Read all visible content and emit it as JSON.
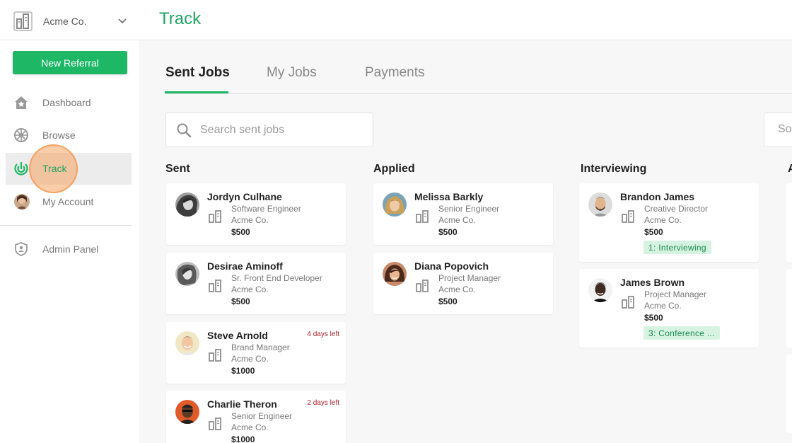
{
  "header": {
    "company_name": "Acme Co.",
    "page_title": "Track"
  },
  "sidebar": {
    "new_referral_label": "New Referral",
    "items": [
      {
        "label": "Dashboard",
        "icon": "star-home-icon"
      },
      {
        "label": "Browse",
        "icon": "compass-icon"
      },
      {
        "label": "Track",
        "icon": "target-icon",
        "active": true
      },
      {
        "label": "My Account",
        "icon": "avatar"
      },
      {
        "label": "Admin Panel",
        "icon": "shield-user-icon"
      }
    ]
  },
  "tabs": [
    {
      "label": "Sent Jobs",
      "active": true
    },
    {
      "label": "My Jobs",
      "active": false
    },
    {
      "label": "Payments",
      "active": false
    }
  ],
  "search": {
    "placeholder": "Search sent jobs",
    "value": ""
  },
  "sort": {
    "label": "Sort"
  },
  "columns": [
    {
      "title": "Sent",
      "cards": [
        {
          "name": "Jordyn Culhane",
          "role": "Software Engineer",
          "company": "Acme Co.",
          "amount": "$500",
          "deadline": "",
          "stage": ""
        },
        {
          "name": "Desirae Aminoff",
          "role": "Sr. Front End Developer",
          "company": "Acme Co.",
          "amount": "$500",
          "deadline": "",
          "stage": ""
        },
        {
          "name": "Steve Arnold",
          "role": "Brand Manager",
          "company": "Acme Co.",
          "amount": "$1000",
          "deadline": "4 days left",
          "stage": ""
        },
        {
          "name": "Charlie Theron",
          "role": "Senior Engineer",
          "company": "Acme Co.",
          "amount": "$1000",
          "deadline": "2 days left",
          "stage": ""
        }
      ]
    },
    {
      "title": "Applied",
      "cards": [
        {
          "name": "Melissa Barkly",
          "role": "Senior Engineer",
          "company": "Acme Co.",
          "amount": "$500",
          "deadline": "",
          "stage": ""
        },
        {
          "name": "Diana Popovich",
          "role": "Project Manager",
          "company": "Acme Co.",
          "amount": "$500",
          "deadline": "",
          "stage": ""
        }
      ]
    },
    {
      "title": "Interviewing",
      "cards": [
        {
          "name": "Brandon James",
          "role": "Creative Director",
          "company": "Acme Co.",
          "amount": "$500",
          "deadline": "",
          "stage": "1: Interviewing"
        },
        {
          "name": "James Brown",
          "role": "Project Manager",
          "company": "Acme Co.",
          "amount": "$500",
          "deadline": "",
          "stage": "3: Conference ..."
        }
      ]
    },
    {
      "title": "A",
      "cards": []
    }
  ],
  "colors": {
    "accent": "#1db766",
    "title_green": "#1fa463",
    "deadline_red": "#b0212b",
    "stage_bg": "#d6f3e2",
    "click_highlight": "#f7a260"
  }
}
